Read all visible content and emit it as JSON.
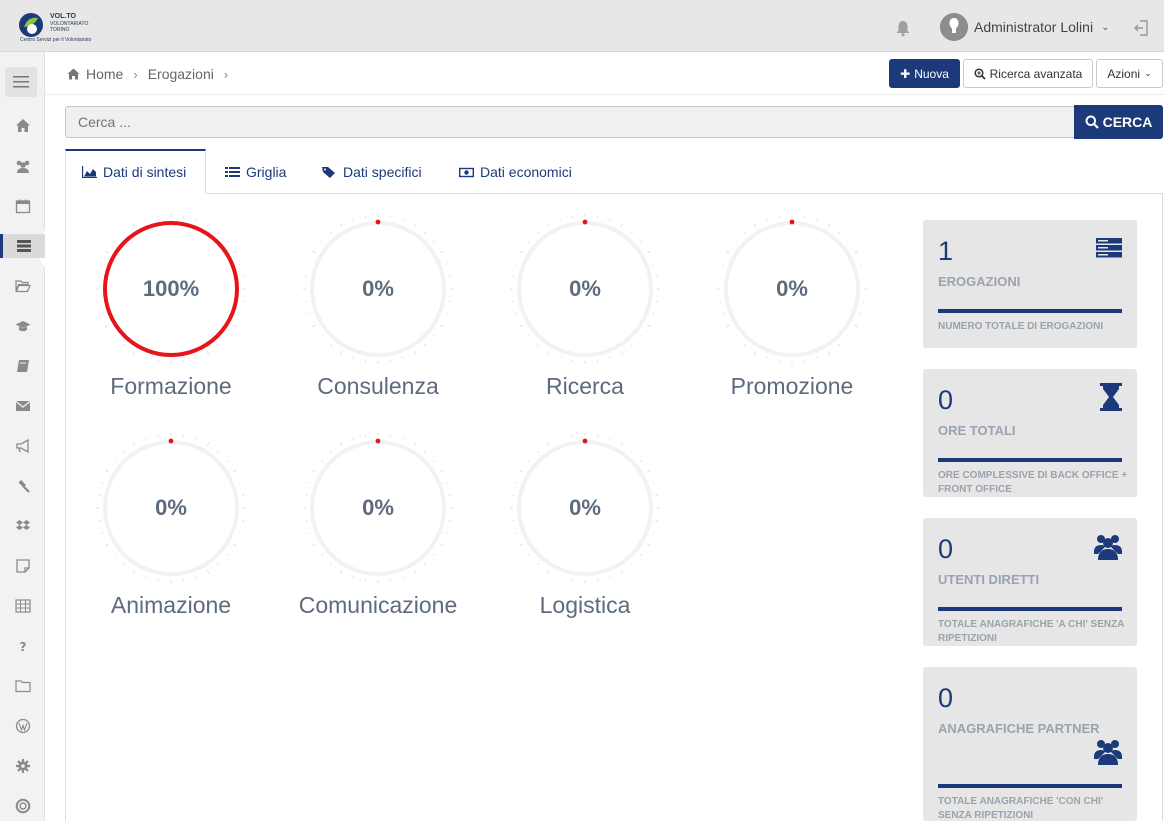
{
  "brand": {
    "line1": "VOL.TO",
    "line2": "VOLONTARIATO\nTORINO",
    "line3": "Centro Servizi per il Volontariato"
  },
  "header": {
    "user_name": "Administrator Lolini",
    "icons": [
      "bell-icon",
      "avatar",
      "chevron-down-icon",
      "logout-icon"
    ]
  },
  "sidebar": {
    "items": [
      {
        "icon": "home-icon"
      },
      {
        "icon": "users-icon"
      },
      {
        "icon": "calendar-icon"
      },
      {
        "icon": "list-icon",
        "active": true
      },
      {
        "icon": "folder-open-icon"
      },
      {
        "icon": "graduation-cap-icon"
      },
      {
        "icon": "book-icon"
      },
      {
        "icon": "envelope-icon"
      },
      {
        "icon": "bullhorn-icon"
      },
      {
        "icon": "gavel-icon"
      },
      {
        "icon": "dropbox-icon"
      },
      {
        "icon": "note-icon"
      },
      {
        "icon": "table-icon"
      },
      {
        "icon": "question-icon"
      },
      {
        "icon": "folder-icon"
      },
      {
        "icon": "wordpress-icon"
      },
      {
        "icon": "gear-icon"
      },
      {
        "icon": "lifebuoy-icon"
      }
    ]
  },
  "breadcrumb": {
    "home": "Home",
    "current": "Erogazioni",
    "sep": "›"
  },
  "toolbar": {
    "nuova": "Nuova",
    "ricerca_avanzata": "Ricerca avanzata",
    "azioni": "Azioni"
  },
  "search": {
    "placeholder": "Cerca ...",
    "button": "CERCA"
  },
  "tabs": [
    {
      "label": "Dati di sintesi",
      "active": true
    },
    {
      "label": "Griglia"
    },
    {
      "label": "Dati specifici"
    },
    {
      "label": "Dati economici"
    }
  ],
  "gauges": [
    {
      "label": "Formazione",
      "pct_text": "100%",
      "value": 100
    },
    {
      "label": "Consulenza",
      "pct_text": "0%",
      "value": 0
    },
    {
      "label": "Ricerca",
      "pct_text": "0%",
      "value": 0
    },
    {
      "label": "Promozione",
      "pct_text": "0%",
      "value": 0
    },
    {
      "label": "Animazione",
      "pct_text": "0%",
      "value": 0
    },
    {
      "label": "Comunicazione",
      "pct_text": "0%",
      "value": 0
    },
    {
      "label": "Logistica",
      "pct_text": "0%",
      "value": 0
    }
  ],
  "stats": [
    {
      "value": "1",
      "title": "EROGAZIONI",
      "desc": "NUMERO TOTALE DI EROGAZIONI",
      "icon": "server-icon"
    },
    {
      "value": "0",
      "title": "ORE TOTALI",
      "desc": "ORE COMPLESSIVE DI BACK OFFICE + FRONT OFFICE",
      "icon": "hourglass-icon"
    },
    {
      "value": "0",
      "title": "UTENTI DIRETTI",
      "desc": "TOTALE ANAGRAFICHE 'A CHI' SENZA RIPETIZIONI",
      "icon": "users-icon"
    },
    {
      "value": "0",
      "title": "ANAGRAFICHE PARTNER",
      "desc": "TOTALE ANAGRAFICHE 'CON CHI' SENZA RIPETIZIONI",
      "icon": "users-icon"
    }
  ],
  "colors": {
    "primary": "#1c3a7a",
    "gauge_full": "#e8141b",
    "gauge_empty": "#f1f2f4",
    "text_muted": "#5d6b7d"
  }
}
